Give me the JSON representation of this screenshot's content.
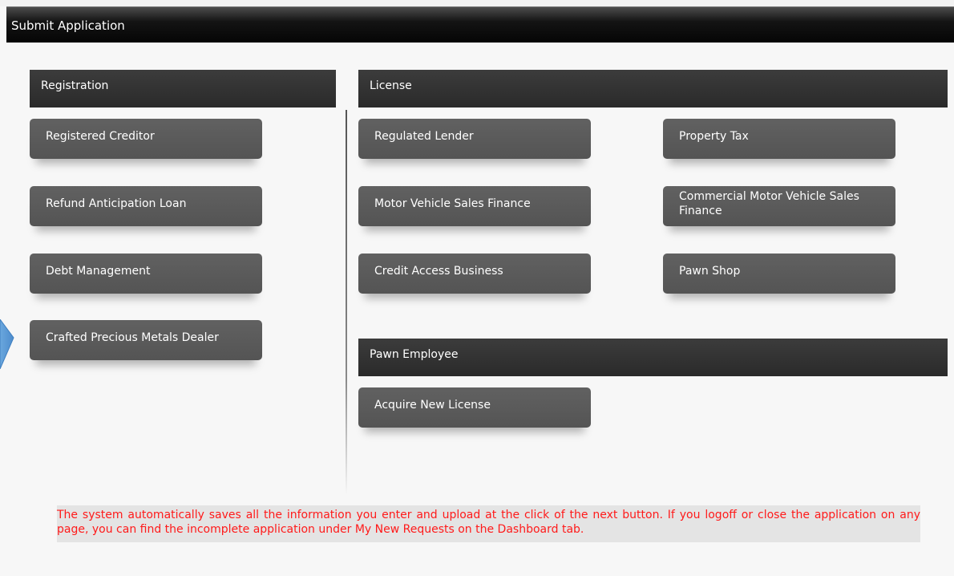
{
  "title": "Submit Application",
  "registration": {
    "header": "Registration",
    "items": [
      {
        "label": "Registered Creditor"
      },
      {
        "label": "Refund Anticipation Loan"
      },
      {
        "label": "Debt Management"
      },
      {
        "label": "Crafted Precious Metals Dealer"
      }
    ]
  },
  "license": {
    "header": "License",
    "items": [
      {
        "label": "Regulated Lender"
      },
      {
        "label": "Property Tax"
      },
      {
        "label": "Motor Vehicle Sales Finance"
      },
      {
        "label": "Commercial Motor Vehicle Sales Finance"
      },
      {
        "label": "Credit Access Business"
      },
      {
        "label": "Pawn Shop"
      }
    ]
  },
  "pawn_employee": {
    "header": "Pawn Employee",
    "items": [
      {
        "label": "Acquire New License"
      }
    ]
  },
  "notice": "The system automatically saves all the information you enter and upload at the click of the next button. If you logoff or close the application on any page, you can find the incomplete application under My New Requests on the Dashboard tab.",
  "colors": {
    "title_bar": "#050505",
    "tile": "#5a5a5a",
    "header": "#333333",
    "notice_text": "#ff1a1a",
    "notice_bg": "#e4e4e4",
    "pointer": "#5b9bd5"
  }
}
